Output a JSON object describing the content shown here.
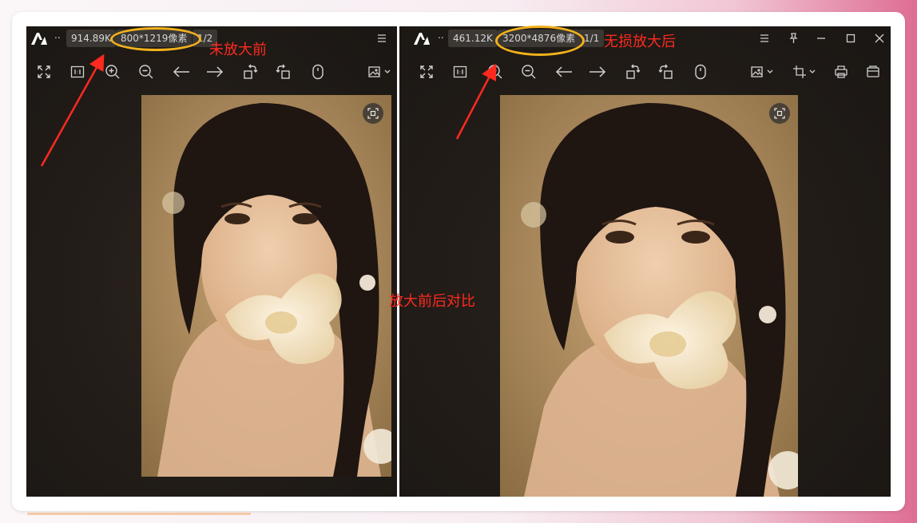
{
  "left_viewer": {
    "file_size": "914.89K",
    "resolution": "800*1219像素",
    "page": "1/2",
    "dots": ".."
  },
  "right_viewer": {
    "file_size": "461.12K",
    "resolution": "3200*4876像素",
    "page": "1/1",
    "dots": ".."
  },
  "annotations": {
    "before_label": "未放大前",
    "after_label": "无损放大后",
    "compare_label": "放大前后对比"
  },
  "colors": {
    "annotation_red": "#ff2a1f",
    "highlight_yellow": "#f3b21b",
    "viewer_bg": "#201b17"
  },
  "toolbar_icons": [
    "fit-screen-icon",
    "actual-size-icon",
    "zoom-in-icon",
    "zoom-out-icon",
    "previous-icon",
    "next-icon",
    "rotate-left-icon",
    "rotate-right-icon",
    "mouse-mode-icon",
    "image-edit-icon",
    "crop-icon",
    "print-icon",
    "open-folder-icon"
  ]
}
